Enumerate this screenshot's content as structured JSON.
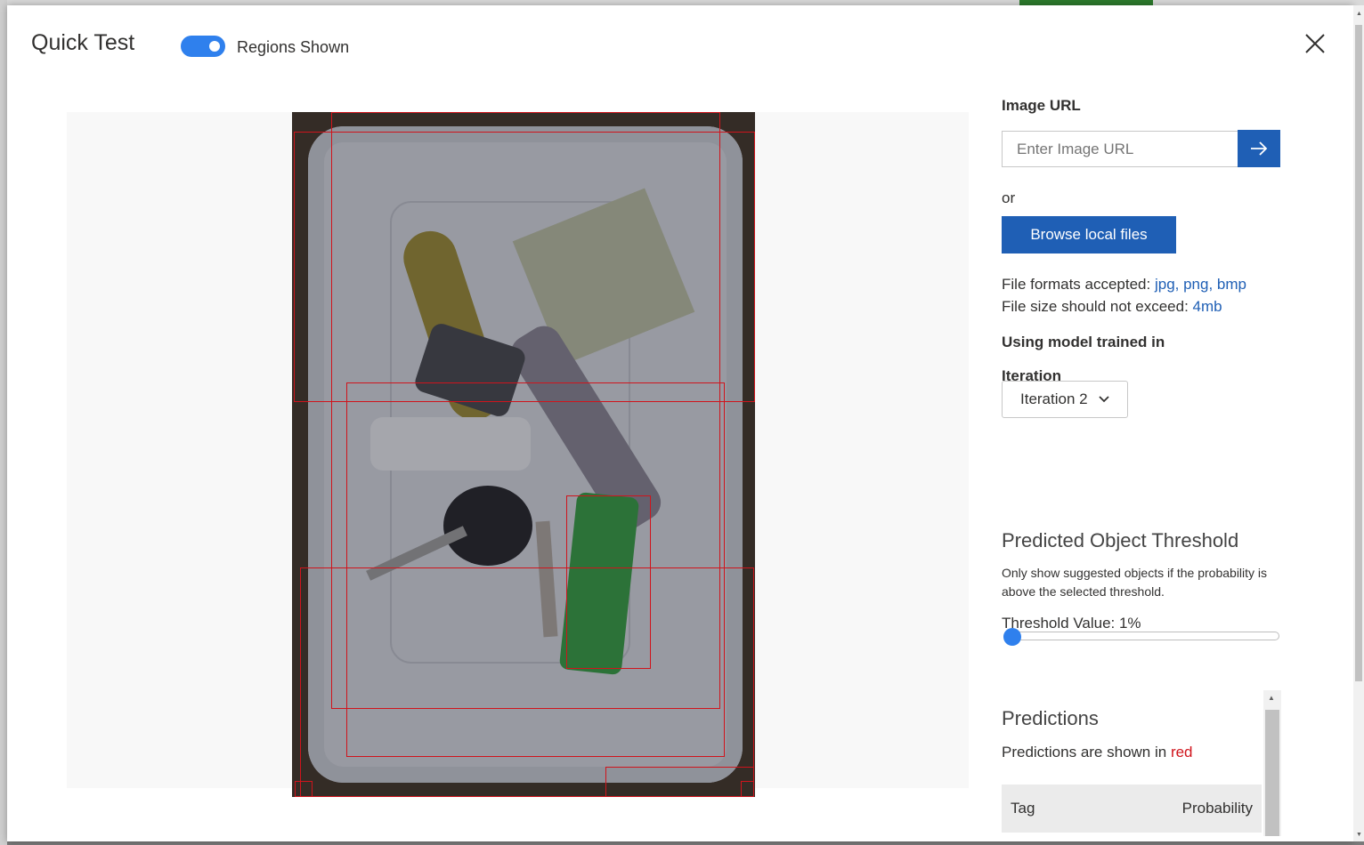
{
  "modal": {
    "title": "Quick Test",
    "toggle_label": "Regions Shown",
    "toggle_on": true
  },
  "upload": {
    "image_url_label": "Image URL",
    "image_url_placeholder": "Enter Image URL",
    "or_text": "or",
    "browse_label": "Browse local files",
    "formats_prefix": "File formats accepted: ",
    "formats": "jpg, png, bmp",
    "size_prefix": "File size should not exceed: ",
    "size": "4mb",
    "model_label": "Using model trained in",
    "iteration_label": "Iteration",
    "iteration_value": "Iteration 2"
  },
  "threshold": {
    "heading": "Predicted Object Threshold",
    "description": "Only show suggested objects if the probability is above the selected threshold.",
    "value_label": "Threshold Value: 1%",
    "value_percent": 1
  },
  "predictions": {
    "heading": "Predictions",
    "note_prefix": "Predictions are shown in ",
    "note_color_word": "red",
    "columns": [
      "Tag",
      "Probability"
    ]
  },
  "colors": {
    "accent": "#2f80ed",
    "button": "#1f5fb5",
    "region": "#d0141c"
  },
  "icons": {
    "close": "close-icon",
    "go": "arrow-right-icon",
    "select": "chevron-down-icon"
  }
}
